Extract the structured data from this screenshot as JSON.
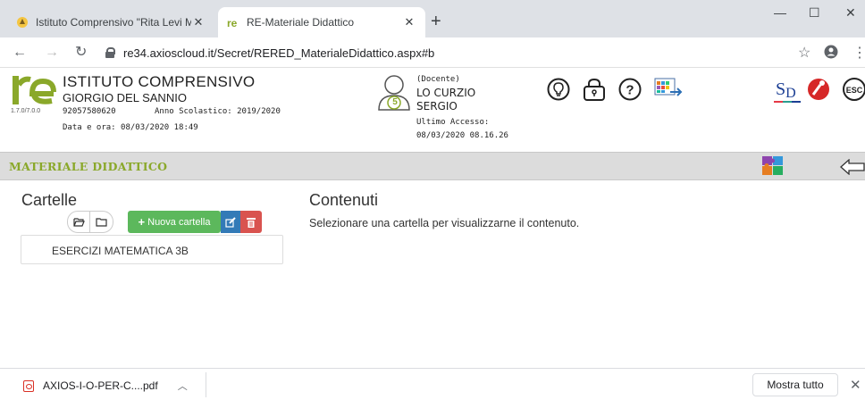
{
  "browser": {
    "tabs": [
      {
        "title": "Istituto Comprensivo \"Rita Levi M",
        "active": false
      },
      {
        "title": "RE-Materiale Didattico",
        "active": true
      }
    ],
    "url": "re34.axioscloud.it/Secret/RERED_MaterialeDidattico.aspx#b"
  },
  "header": {
    "version": "1.7.0/7.0.0",
    "school_line1": "ISTITUTO COMPRENSIVO",
    "school_line2": "GIORGIO DEL SANNIO",
    "school_code": "92057580620",
    "school_year": "Anno Scolastico: 2019/2020",
    "datetime": "Data e ora: 08/03/2020 18:49",
    "role": "(Docente)",
    "name_line1": "LO CURZIO",
    "name_line2": "SERGIO",
    "last_access_label": "Ultimo Accesso:",
    "last_access": "08/03/2020 08.16.26",
    "avatar_badge": "5"
  },
  "section": {
    "title": "MATERIALE DIDATTICO"
  },
  "cartelle": {
    "title": "Cartelle",
    "new_folder_label": "Nuova cartella",
    "folders": [
      "ESERCIZI MATEMATICA 3B"
    ]
  },
  "contenuti": {
    "title": "Contenuti",
    "message": "Selezionare una cartella per visualizzarne il contenuto."
  },
  "downloads": {
    "file": "AXIOS-I-O-PER-C....pdf",
    "show_all": "Mostra tutto"
  },
  "colors": {
    "accent_green": "#8aa82a",
    "btn_green": "#5cb85c",
    "btn_blue": "#337ab7",
    "btn_red": "#d9534f"
  }
}
